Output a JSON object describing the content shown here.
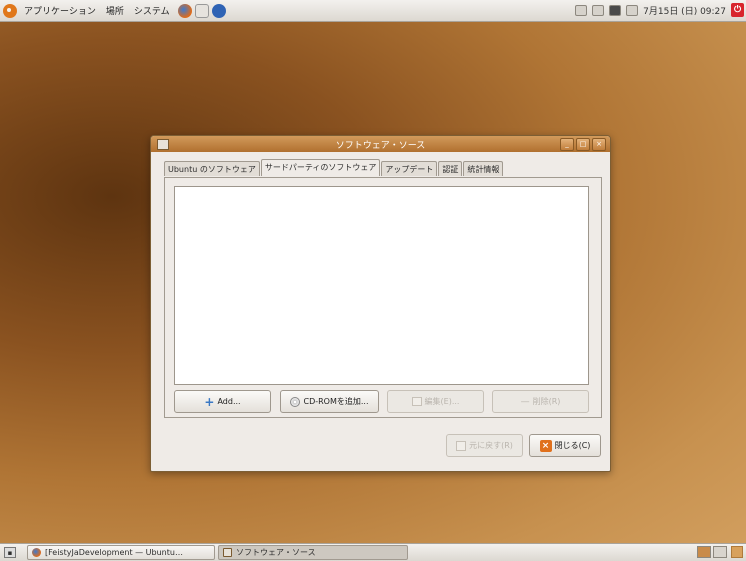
{
  "top_panel": {
    "menus": [
      "アプリケーション",
      "場所",
      "システム"
    ],
    "clock": "7月15日 (日) 09:27"
  },
  "window": {
    "title": "ソフトウェア・ソース",
    "tabs": [
      {
        "label": "Ubuntu のソフトウェア",
        "active": false
      },
      {
        "label": "サードパーティのソフトウェア",
        "active": true
      },
      {
        "label": "アップデート",
        "active": false
      },
      {
        "label": "認証",
        "active": false
      },
      {
        "label": "統計情報",
        "active": false
      }
    ],
    "buttons": {
      "add": "Add...",
      "add_cdrom": "CD-ROMを追加...",
      "edit": "編集(E)...",
      "remove": "削除(R)",
      "revert": "元に戻す(R)",
      "close": "閉じる(C)"
    }
  },
  "bottom_panel": {
    "tasks": [
      "[FeistyJaDevelopment — Ubuntu…",
      "ソフトウェア・ソース"
    ]
  },
  "colors": {
    "window_title_bar": "#b0702f",
    "close_button_accent": "#e0701c",
    "logout_red": "#d8252c"
  }
}
